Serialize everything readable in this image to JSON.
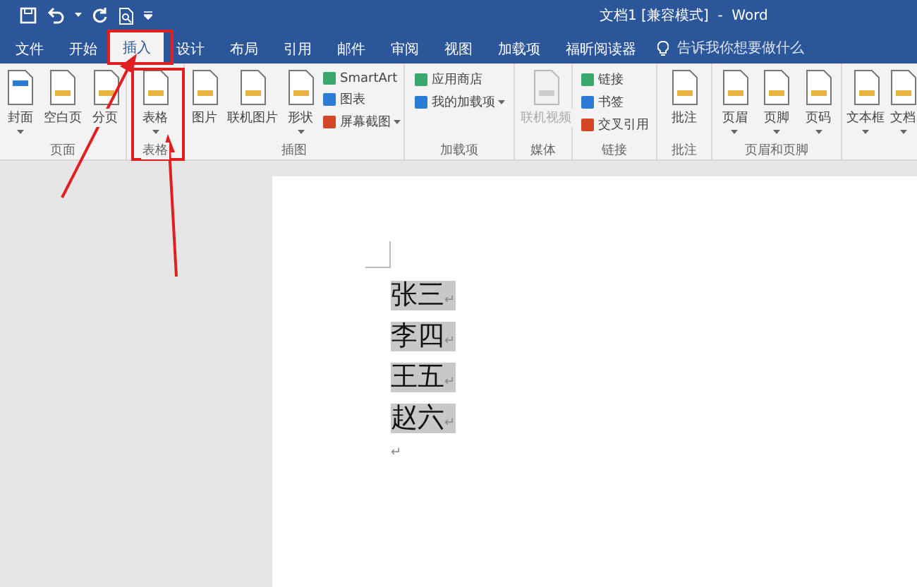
{
  "window": {
    "title": "文档1 [兼容模式]  -  Word"
  },
  "tabs": [
    {
      "label": "文件",
      "selected": false
    },
    {
      "label": "开始",
      "selected": false
    },
    {
      "label": "插入",
      "selected": true
    },
    {
      "label": "设计",
      "selected": false
    },
    {
      "label": "布局",
      "selected": false
    },
    {
      "label": "引用",
      "selected": false
    },
    {
      "label": "邮件",
      "selected": false
    },
    {
      "label": "审阅",
      "selected": false
    },
    {
      "label": "视图",
      "selected": false
    },
    {
      "label": "加载项",
      "selected": false
    },
    {
      "label": "福昕阅读器",
      "selected": false
    }
  ],
  "tell_me": {
    "placeholder": "告诉我你想要做什么"
  },
  "ribbon_groups": [
    {
      "label": "页面",
      "items": [
        {
          "kind": "large",
          "label": "封面",
          "dropdown": true,
          "disabled": false
        },
        {
          "kind": "large",
          "label": "空白页",
          "dropdown": false,
          "disabled": false
        },
        {
          "kind": "large",
          "label": "分页",
          "dropdown": false,
          "disabled": false
        }
      ]
    },
    {
      "label": "表格",
      "items": [
        {
          "kind": "large",
          "label": "表格",
          "dropdown": true,
          "disabled": false
        }
      ]
    },
    {
      "label": "插图",
      "items": [
        {
          "kind": "large",
          "label": "图片",
          "dropdown": false,
          "disabled": false
        },
        {
          "kind": "large",
          "label": "联机图片",
          "dropdown": false,
          "disabled": false
        },
        {
          "kind": "large",
          "label": "形状",
          "dropdown": true,
          "disabled": false
        },
        {
          "kind": "stack",
          "children": [
            {
              "label": "SmartArt",
              "dropdown": false
            },
            {
              "label": "图表",
              "dropdown": false
            },
            {
              "label": "屏幕截图",
              "dropdown": true
            }
          ]
        }
      ]
    },
    {
      "label": "加载项",
      "items": [
        {
          "kind": "stack",
          "children": [
            {
              "label": "应用商店",
              "dropdown": false
            },
            {
              "label": "我的加载项",
              "dropdown": true
            }
          ]
        }
      ]
    },
    {
      "label": "媒体",
      "items": [
        {
          "kind": "large",
          "label": "联机视频",
          "dropdown": false,
          "disabled": true
        }
      ]
    },
    {
      "label": "链接",
      "items": [
        {
          "kind": "stack",
          "children": [
            {
              "label": "链接",
              "dropdown": false
            },
            {
              "label": "书签",
              "dropdown": false
            },
            {
              "label": "交叉引用",
              "dropdown": false
            }
          ]
        }
      ]
    },
    {
      "label": "批注",
      "items": [
        {
          "kind": "large",
          "label": "批注",
          "dropdown": false,
          "disabled": false
        }
      ]
    },
    {
      "label": "页眉和页脚",
      "items": [
        {
          "kind": "large",
          "label": "页眉",
          "dropdown": true,
          "disabled": false
        },
        {
          "kind": "large",
          "label": "页脚",
          "dropdown": true,
          "disabled": false
        },
        {
          "kind": "large",
          "label": "页码",
          "dropdown": true,
          "disabled": false
        }
      ]
    },
    {
      "items": [
        {
          "kind": "large",
          "label": "文本框",
          "dropdown": true,
          "disabled": false
        },
        {
          "kind": "large",
          "label": "文档",
          "dropdown": true,
          "disabled": false
        }
      ]
    }
  ],
  "document": {
    "paragraphs": [
      {
        "text": "张三",
        "selected": true
      },
      {
        "text": "李四",
        "selected": true
      },
      {
        "text": "王五",
        "selected": true
      },
      {
        "text": "赵六",
        "selected": true
      },
      {
        "selected": false
      }
    ],
    "paragraph_mark": "↵"
  }
}
